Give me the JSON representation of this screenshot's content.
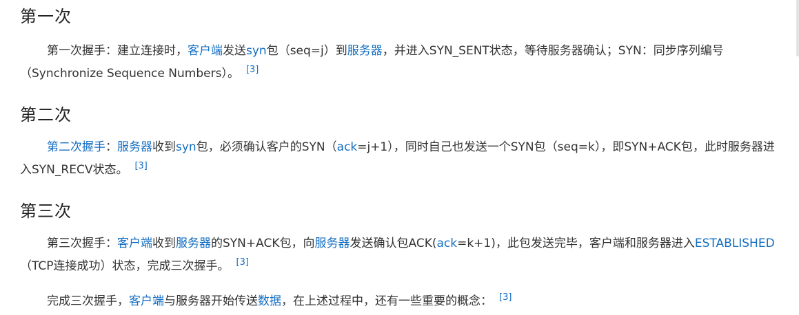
{
  "sections": [
    {
      "title": "第一次",
      "paragraph": [
        {
          "t": "第一次握手：建立连接时，",
          "link": false
        },
        {
          "t": "客户端",
          "link": true
        },
        {
          "t": "发送",
          "link": false
        },
        {
          "t": "syn",
          "link": true
        },
        {
          "t": "包（seq=j）到",
          "link": false
        },
        {
          "t": "服务器",
          "link": true
        },
        {
          "t": "，并进入SYN_SENT状态，等待服务器确认；SYN：同步序列编号（Synchronize Sequence Numbers）。",
          "link": false
        }
      ],
      "ref": "[3]"
    },
    {
      "title": "第二次",
      "paragraph": [
        {
          "t": "第二次握手",
          "link": true
        },
        {
          "t": "：",
          "link": false
        },
        {
          "t": "服务器",
          "link": true
        },
        {
          "t": "收到",
          "link": false
        },
        {
          "t": "syn",
          "link": true
        },
        {
          "t": "包，必须确认客户的SYN（",
          "link": false
        },
        {
          "t": "ack",
          "link": true
        },
        {
          "t": "=j+1），同时自己也发送一个SYN包（seq=k），即SYN+ACK包，此时服务器进入SYN_RECV状态。",
          "link": false
        }
      ],
      "ref": "[3]"
    },
    {
      "title": "第三次",
      "paragraph": [
        {
          "t": "第三次握手：",
          "link": false
        },
        {
          "t": "客户端",
          "link": true
        },
        {
          "t": "收到",
          "link": false
        },
        {
          "t": "服务器",
          "link": true
        },
        {
          "t": "的SYN+ACK包，向",
          "link": false
        },
        {
          "t": "服务器",
          "link": true
        },
        {
          "t": "发送确认包ACK(",
          "link": false
        },
        {
          "t": "ack",
          "link": true
        },
        {
          "t": "=k+1)，此包发送完毕，客户端和服务器进入",
          "link": false
        },
        {
          "t": "ESTABLISHED",
          "link": true
        },
        {
          "t": "（TCP连接成功）状态，完成三次握手。",
          "link": false
        }
      ],
      "ref": "[3]"
    }
  ],
  "closing": {
    "paragraph": [
      {
        "t": "完成三次握手，",
        "link": false
      },
      {
        "t": "客户端",
        "link": true
      },
      {
        "t": "与服务器开始传送",
        "link": false
      },
      {
        "t": "数据",
        "link": true
      },
      {
        "t": "，在上述过程中，还有一些重要的概念：",
        "link": false
      }
    ],
    "ref": "[3]"
  },
  "colors": {
    "link": "#136ec2",
    "text": "#333333",
    "heading": "#222222"
  }
}
